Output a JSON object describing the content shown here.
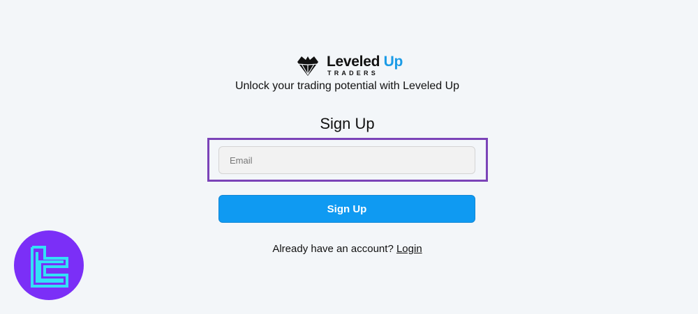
{
  "brand": {
    "name_part1": "Leveled",
    "name_part2": "Up",
    "sub": "TRADERS",
    "accent_color": "#1a9be6"
  },
  "tagline": "Unlock your trading potential with Leveled Up",
  "form": {
    "title": "Sign Up",
    "email_placeholder": "Email",
    "submit_label": "Sign Up",
    "highlight_color": "#7b43b8",
    "button_color": "#0f9af2"
  },
  "footer": {
    "account_prompt": "Already have an account?",
    "login_label": "Login"
  },
  "badge": {
    "icon": "tradingfinder-logo-icon",
    "circle_color": "#7b2ff7",
    "glyph_color": "#33e0f7"
  }
}
